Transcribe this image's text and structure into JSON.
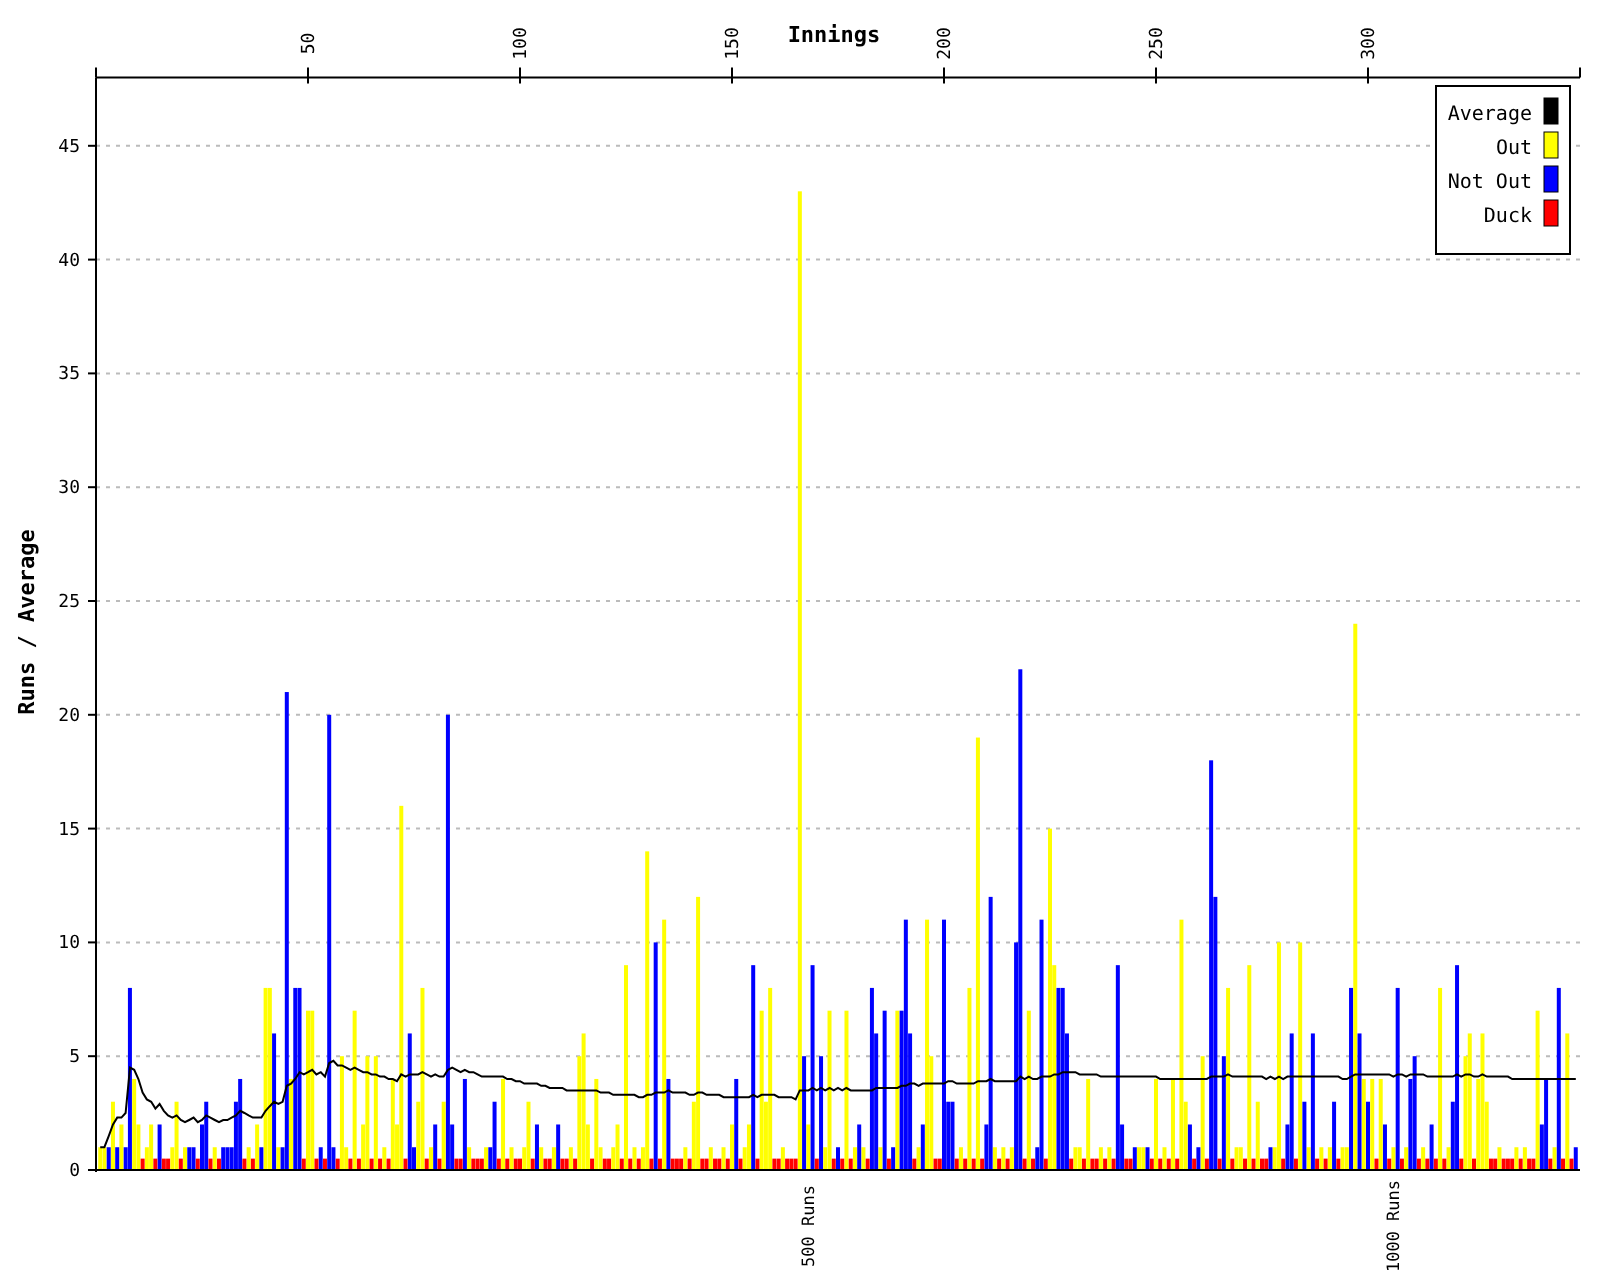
{
  "chart": {
    "chart_data": {
      "type": "bar",
      "xlabel": "Innings",
      "ylabel": "Runs / Average",
      "xlim": [
        0,
        350
      ],
      "ylim": [
        0,
        48
      ],
      "grid": true,
      "legend": "upper right",
      "xticks": [
        50,
        100,
        150,
        200,
        250,
        300
      ],
      "yticks": [
        0,
        5,
        10,
        15,
        20,
        25,
        30,
        35,
        40,
        45
      ],
      "x": [
        1,
        2,
        3,
        4,
        5,
        6,
        7,
        8,
        9,
        10,
        11,
        12,
        13,
        14,
        15,
        16,
        17,
        18,
        19,
        20,
        21,
        22,
        23,
        24,
        25,
        26,
        27,
        28,
        29,
        30,
        31,
        32,
        33,
        34,
        35,
        36,
        37,
        38,
        39,
        40,
        41,
        42,
        43,
        44,
        45,
        46,
        47,
        48,
        49,
        50,
        51,
        52,
        53,
        54,
        55,
        56,
        57,
        58,
        59,
        60,
        61,
        62,
        63,
        64,
        65,
        66,
        67,
        68,
        69,
        70,
        71,
        72,
        73,
        74,
        75,
        76,
        77,
        78,
        79,
        80,
        81,
        82,
        83,
        84,
        85,
        86,
        87,
        88,
        89,
        90,
        91,
        92,
        93,
        94,
        95,
        96,
        97,
        98,
        99,
        100,
        101,
        102,
        103,
        104,
        105,
        106,
        107,
        108,
        109,
        110,
        111,
        112,
        113,
        114,
        115,
        116,
        117,
        118,
        119,
        120,
        121,
        122,
        123,
        124,
        125,
        126,
        127,
        128,
        129,
        130,
        131,
        132,
        133,
        134,
        135,
        136,
        137,
        138,
        139,
        140,
        141,
        142,
        143,
        144,
        145,
        146,
        147,
        148,
        149,
        150,
        151,
        152,
        153,
        154,
        155,
        156,
        157,
        158,
        159,
        160,
        161,
        162,
        163,
        164,
        165,
        166,
        167,
        168,
        169,
        170,
        171,
        172,
        173,
        174,
        175,
        176,
        177,
        178,
        179,
        180,
        181,
        182,
        183,
        184,
        185,
        186,
        187,
        188,
        189,
        190,
        191,
        192,
        193,
        194,
        195,
        196,
        197,
        198,
        199,
        200,
        201,
        202,
        203,
        204,
        205,
        206,
        207,
        208,
        209,
        210,
        211,
        212,
        213,
        214,
        215,
        216,
        217,
        218,
        219,
        220,
        221,
        222,
        223,
        224,
        225,
        226,
        227,
        228,
        229,
        230,
        231,
        232,
        233,
        234,
        235,
        236,
        237,
        238,
        239,
        240,
        241,
        242,
        243,
        244,
        245,
        246,
        247,
        248,
        249,
        250,
        251,
        252,
        253,
        254,
        255,
        256,
        257,
        258,
        259,
        260,
        261,
        262,
        263,
        264,
        265,
        266,
        267,
        268,
        269,
        270,
        271,
        272,
        273,
        274,
        275,
        276,
        277,
        278,
        279,
        280,
        281,
        282,
        283,
        284,
        285,
        286,
        287,
        288,
        289,
        290,
        291,
        292,
        293,
        294,
        295,
        296,
        297,
        298,
        299,
        300,
        301,
        302,
        303,
        304,
        305,
        306,
        307,
        308,
        309,
        310,
        311,
        312,
        313,
        314,
        315,
        316,
        317,
        318,
        319,
        320,
        321,
        322,
        323,
        324,
        325,
        326,
        327,
        328,
        329,
        330,
        331,
        332,
        333,
        334,
        335,
        336,
        337,
        338,
        339,
        340,
        341,
        342,
        343,
        344,
        345,
        346,
        347,
        348,
        349
      ],
      "series": [
        {
          "name": "Average",
          "color": "#000000",
          "type": "line",
          "values": [
            1.0,
            1.0,
            1.5,
            2.0,
            2.3,
            2.3,
            2.5,
            4.5,
            4.4,
            4.0,
            3.4,
            3.1,
            3.0,
            2.7,
            2.9,
            2.6,
            2.4,
            2.3,
            2.4,
            2.2,
            2.1,
            2.2,
            2.3,
            2.1,
            2.2,
            2.4,
            2.3,
            2.2,
            2.1,
            2.2,
            2.2,
            2.3,
            2.4,
            2.6,
            2.5,
            2.4,
            2.3,
            2.3,
            2.3,
            2.6,
            2.8,
            3.0,
            2.9,
            3.0,
            3.7,
            3.8,
            4.0,
            4.3,
            4.2,
            4.3,
            4.4,
            4.2,
            4.3,
            4.1,
            4.7,
            4.8,
            4.6,
            4.6,
            4.5,
            4.4,
            4.5,
            4.4,
            4.3,
            4.3,
            4.2,
            4.2,
            4.1,
            4.1,
            4.0,
            4.0,
            3.9,
            4.2,
            4.1,
            4.2,
            4.2,
            4.2,
            4.3,
            4.2,
            4.1,
            4.2,
            4.1,
            4.1,
            4.4,
            4.5,
            4.4,
            4.3,
            4.4,
            4.3,
            4.3,
            4.2,
            4.1,
            4.1,
            4.1,
            4.1,
            4.1,
            4.1,
            4.0,
            4.0,
            3.9,
            3.9,
            3.8,
            3.8,
            3.8,
            3.8,
            3.7,
            3.7,
            3.6,
            3.6,
            3.6,
            3.6,
            3.5,
            3.5,
            3.5,
            3.5,
            3.5,
            3.5,
            3.5,
            3.5,
            3.4,
            3.4,
            3.4,
            3.3,
            3.3,
            3.3,
            3.3,
            3.3,
            3.3,
            3.2,
            3.2,
            3.3,
            3.3,
            3.4,
            3.4,
            3.4,
            3.5,
            3.4,
            3.4,
            3.4,
            3.4,
            3.3,
            3.3,
            3.4,
            3.4,
            3.3,
            3.3,
            3.3,
            3.3,
            3.2,
            3.2,
            3.2,
            3.2,
            3.2,
            3.2,
            3.2,
            3.3,
            3.2,
            3.3,
            3.3,
            3.3,
            3.3,
            3.2,
            3.2,
            3.2,
            3.2,
            3.1,
            3.5,
            3.5,
            3.5,
            3.6,
            3.5,
            3.6,
            3.5,
            3.6,
            3.5,
            3.6,
            3.5,
            3.6,
            3.5,
            3.5,
            3.5,
            3.5,
            3.5,
            3.5,
            3.6,
            3.6,
            3.6,
            3.6,
            3.6,
            3.6,
            3.7,
            3.7,
            3.8,
            3.8,
            3.7,
            3.8,
            3.8,
            3.8,
            3.8,
            3.8,
            3.8,
            3.9,
            3.9,
            3.8,
            3.8,
            3.8,
            3.8,
            3.8,
            3.9,
            3.9,
            3.9,
            4.0,
            3.9,
            3.9,
            3.9,
            3.9,
            3.9,
            3.9,
            4.1,
            4.0,
            4.1,
            4.0,
            4.0,
            4.1,
            4.1,
            4.1,
            4.2,
            4.2,
            4.3,
            4.3,
            4.3,
            4.3,
            4.2,
            4.2,
            4.2,
            4.2,
            4.2,
            4.1,
            4.1,
            4.1,
            4.1,
            4.1,
            4.1,
            4.1,
            4.1,
            4.1,
            4.1,
            4.1,
            4.1,
            4.1,
            4.1,
            4.0,
            4.0,
            4.0,
            4.0,
            4.0,
            4.0,
            4.0,
            4.0,
            4.0,
            4.0,
            4.0,
            4.0,
            4.1,
            4.1,
            4.1,
            4.1,
            4.2,
            4.1,
            4.1,
            4.1,
            4.1,
            4.1,
            4.1,
            4.1,
            4.1,
            4.0,
            4.1,
            4.0,
            4.1,
            4.0,
            4.1,
            4.1,
            4.1,
            4.1,
            4.1,
            4.1,
            4.1,
            4.1,
            4.1,
            4.1,
            4.1,
            4.1,
            4.1,
            4.0,
            4.0,
            4.1,
            4.2,
            4.2,
            4.2,
            4.2,
            4.2,
            4.2,
            4.2,
            4.2,
            4.2,
            4.1,
            4.2,
            4.2,
            4.1,
            4.2,
            4.2,
            4.2,
            4.2,
            4.1,
            4.1,
            4.1,
            4.1,
            4.1,
            4.1,
            4.1,
            4.2,
            4.1,
            4.2,
            4.2,
            4.1,
            4.1,
            4.2,
            4.1,
            4.1,
            4.1,
            4.1,
            4.1,
            4.1,
            4.0,
            4.0,
            4.0,
            4.0,
            4.0,
            4.0,
            4.0,
            4.0,
            4.0,
            4.0,
            4.0,
            4.0,
            4.0,
            4.0,
            4.0,
            4.0
          ]
        },
        {
          "name": "Out",
          "color": "#ffff00",
          "values": [
            1,
            1,
            null,
            3,
            null,
            2,
            null,
            null,
            4,
            2,
            null,
            1,
            2,
            null,
            null,
            null,
            null,
            1,
            3,
            null,
            1,
            null,
            null,
            null,
            null,
            null,
            null,
            1,
            null,
            null,
            null,
            null,
            null,
            null,
            null,
            1,
            null,
            2,
            null,
            8,
            8,
            null,
            1,
            null,
            null,
            4,
            null,
            null,
            null,
            7,
            7,
            null,
            null,
            null,
            null,
            null,
            null,
            5,
            1,
            null,
            7,
            null,
            2,
            5,
            null,
            5,
            null,
            1,
            null,
            4,
            2,
            16,
            null,
            null,
            null,
            3,
            8,
            null,
            1,
            null,
            null,
            3,
            null,
            null,
            null,
            null,
            null,
            1,
            null,
            null,
            null,
            1,
            null,
            null,
            null,
            4,
            null,
            1,
            null,
            null,
            1,
            3,
            null,
            null,
            1,
            null,
            null,
            1,
            null,
            null,
            null,
            1,
            null,
            5,
            6,
            2,
            null,
            4,
            1,
            null,
            null,
            1,
            2,
            null,
            9,
            null,
            1,
            null,
            1,
            14,
            null,
            null,
            null,
            11,
            null,
            null,
            null,
            null,
            1,
            null,
            3,
            12,
            null,
            null,
            1,
            null,
            null,
            1,
            null,
            2,
            null,
            null,
            1,
            2,
            null,
            null,
            7,
            3,
            8,
            null,
            null,
            1,
            null,
            null,
            null,
            43,
            null,
            2,
            null,
            null,
            null,
            1,
            7,
            null,
            null,
            null,
            7,
            null,
            1,
            null,
            1,
            null,
            null,
            null,
            1,
            null,
            null,
            null,
            7,
            null,
            null,
            null,
            null,
            1,
            null,
            11,
            5,
            null,
            null,
            null,
            null,
            null,
            null,
            1,
            null,
            8,
            null,
            19,
            null,
            null,
            null,
            1,
            null,
            1,
            null,
            1,
            null,
            null,
            null,
            7,
            null,
            null,
            null,
            null,
            15,
            9,
            null,
            null,
            null,
            null,
            1,
            1,
            null,
            4,
            null,
            null,
            1,
            null,
            1,
            null,
            null,
            null,
            null,
            null,
            null,
            1,
            1,
            null,
            null,
            4,
            null,
            1,
            null,
            4,
            null,
            11,
            3,
            null,
            null,
            null,
            5,
            null,
            null,
            null,
            null,
            null,
            8,
            null,
            1,
            1,
            null,
            9,
            null,
            3,
            null,
            null,
            null,
            1,
            10,
            null,
            null,
            null,
            null,
            10,
            null,
            1,
            null,
            null,
            1,
            null,
            1,
            null,
            null,
            1,
            1,
            null,
            24,
            null,
            4,
            null,
            4,
            null,
            4,
            null,
            null,
            1,
            null,
            null,
            1,
            null,
            null,
            null,
            1,
            null,
            null,
            null,
            8,
            null,
            1,
            null,
            null,
            null,
            5,
            6,
            null,
            4,
            6,
            3,
            null,
            null,
            1,
            null,
            null,
            null,
            1,
            null,
            1,
            null,
            null,
            7,
            null,
            null,
            null,
            1,
            null,
            null,
            6,
            null,
            null
          ]
        },
        {
          "name": "Not Out",
          "color": "#0000ff",
          "values": [
            null,
            null,
            1,
            null,
            1,
            null,
            1,
            8,
            null,
            null,
            null,
            null,
            null,
            null,
            2,
            null,
            null,
            null,
            null,
            null,
            null,
            1,
            1,
            null,
            2,
            3,
            null,
            null,
            null,
            1,
            1,
            1,
            3,
            4,
            null,
            null,
            null,
            null,
            1,
            null,
            null,
            6,
            null,
            1,
            21,
            null,
            8,
            8,
            null,
            null,
            null,
            null,
            1,
            null,
            20,
            1,
            null,
            null,
            null,
            null,
            null,
            null,
            null,
            null,
            null,
            null,
            null,
            null,
            null,
            null,
            null,
            null,
            null,
            6,
            1,
            null,
            null,
            null,
            null,
            2,
            null,
            null,
            20,
            2,
            null,
            null,
            4,
            null,
            null,
            null,
            null,
            null,
            1,
            3,
            null,
            null,
            null,
            null,
            null,
            null,
            null,
            null,
            null,
            2,
            null,
            null,
            null,
            null,
            2,
            null,
            null,
            null,
            null,
            null,
            null,
            null,
            null,
            null,
            null,
            null,
            null,
            null,
            null,
            null,
            null,
            null,
            null,
            null,
            null,
            null,
            null,
            10,
            null,
            null,
            4,
            null,
            null,
            null,
            null,
            null,
            null,
            null,
            null,
            null,
            null,
            null,
            null,
            null,
            null,
            null,
            4,
            null,
            null,
            null,
            9,
            null,
            null,
            null,
            null,
            null,
            null,
            null,
            null,
            null,
            null,
            null,
            5,
            null,
            9,
            null,
            5,
            null,
            null,
            null,
            1,
            null,
            null,
            null,
            null,
            2,
            null,
            null,
            8,
            6,
            null,
            7,
            null,
            1,
            null,
            7,
            11,
            6,
            null,
            null,
            2,
            null,
            null,
            null,
            null,
            11,
            3,
            3,
            null,
            null,
            null,
            null,
            null,
            null,
            null,
            2,
            12,
            null,
            null,
            null,
            null,
            null,
            10,
            22,
            null,
            null,
            null,
            1,
            11,
            null,
            null,
            null,
            8,
            8,
            6,
            null,
            null,
            null,
            null,
            null,
            null,
            null,
            null,
            null,
            null,
            null,
            9,
            2,
            null,
            null,
            1,
            null,
            null,
            1,
            null,
            null,
            null,
            null,
            null,
            null,
            null,
            null,
            null,
            2,
            null,
            1,
            null,
            null,
            18,
            12,
            null,
            5,
            null,
            null,
            null,
            null,
            null,
            null,
            null,
            null,
            null,
            null,
            1,
            null,
            null,
            null,
            2,
            6,
            null,
            null,
            3,
            null,
            6,
            null,
            null,
            null,
            null,
            3,
            null,
            null,
            null,
            8,
            null,
            6,
            null,
            3,
            null,
            null,
            null,
            2,
            null,
            null,
            8,
            null,
            null,
            4,
            5,
            null,
            null,
            null,
            2,
            null,
            null,
            null,
            null,
            3,
            9,
            null,
            null,
            null,
            null,
            null,
            null,
            null,
            null,
            null,
            null,
            null,
            null,
            null,
            null,
            null,
            null,
            null,
            null,
            null,
            2,
            4,
            null,
            null,
            8,
            null,
            null,
            null,
            1
          ]
        },
        {
          "name": "Duck",
          "color": "#ff0000",
          "values": [
            null,
            null,
            null,
            null,
            null,
            null,
            null,
            null,
            null,
            null,
            0,
            null,
            null,
            0,
            null,
            0,
            0,
            null,
            null,
            0,
            null,
            null,
            null,
            0,
            null,
            null,
            0,
            null,
            0,
            null,
            null,
            null,
            null,
            null,
            0,
            null,
            0,
            null,
            null,
            null,
            null,
            null,
            null,
            null,
            null,
            null,
            null,
            null,
            0,
            null,
            null,
            0,
            null,
            0,
            null,
            null,
            0,
            null,
            null,
            0,
            null,
            0,
            null,
            null,
            0,
            null,
            0,
            null,
            0,
            null,
            null,
            null,
            0,
            null,
            null,
            null,
            null,
            0,
            null,
            null,
            0,
            null,
            null,
            null,
            0,
            0,
            null,
            null,
            0,
            0,
            0,
            null,
            null,
            null,
            0,
            null,
            0,
            null,
            0,
            0,
            null,
            null,
            0,
            null,
            null,
            0,
            0,
            null,
            null,
            0,
            0,
            null,
            0,
            null,
            null,
            null,
            0,
            null,
            null,
            0,
            0,
            null,
            null,
            0,
            null,
            0,
            null,
            0,
            null,
            null,
            0,
            null,
            0,
            null,
            null,
            0,
            0,
            0,
            null,
            0,
            null,
            null,
            0,
            0,
            null,
            0,
            0,
            null,
            0,
            null,
            null,
            0,
            null,
            null,
            null,
            0,
            null,
            null,
            null,
            0,
            0,
            null,
            0,
            0,
            0,
            null,
            null,
            null,
            null,
            0,
            null,
            null,
            null,
            0,
            null,
            0,
            null,
            0,
            null,
            null,
            null,
            0,
            null,
            null,
            null,
            null,
            0,
            null,
            null,
            null,
            null,
            null,
            0,
            null,
            null,
            null,
            null,
            0,
            0,
            null,
            null,
            null,
            0,
            null,
            0,
            null,
            0,
            null,
            0,
            null,
            null,
            null,
            0,
            null,
            0,
            null,
            null,
            null,
            0,
            null,
            0,
            null,
            null,
            0,
            null,
            null,
            null,
            null,
            null,
            0,
            null,
            null,
            0,
            null,
            0,
            0,
            null,
            0,
            null,
            0,
            null,
            null,
            0,
            0,
            null,
            null,
            null,
            null,
            0,
            null,
            0,
            null,
            0,
            null,
            0,
            null,
            null,
            null,
            0,
            null,
            null,
            0,
            null,
            null,
            0,
            null,
            null,
            0,
            null,
            null,
            0,
            null,
            0,
            null,
            0,
            0,
            null,
            null,
            null,
            0,
            null,
            null,
            0,
            null,
            null,
            null,
            null,
            0,
            null,
            0,
            null,
            null,
            0,
            null,
            null,
            null,
            null,
            null,
            null,
            null,
            null,
            0,
            null,
            null,
            0,
            null,
            null,
            0,
            null,
            null,
            null,
            0,
            null,
            0,
            null,
            0,
            null,
            0,
            null,
            null,
            null,
            0,
            null,
            null,
            0,
            null,
            null,
            null,
            0,
            0,
            null,
            0,
            0,
            0,
            null,
            0,
            null,
            0,
            0,
            null,
            null,
            null,
            0,
            null,
            null,
            0,
            null,
            0,
            null
          ]
        }
      ],
      "annotations": [
        "500 Runs",
        "1000 Runs"
      ]
    }
  }
}
